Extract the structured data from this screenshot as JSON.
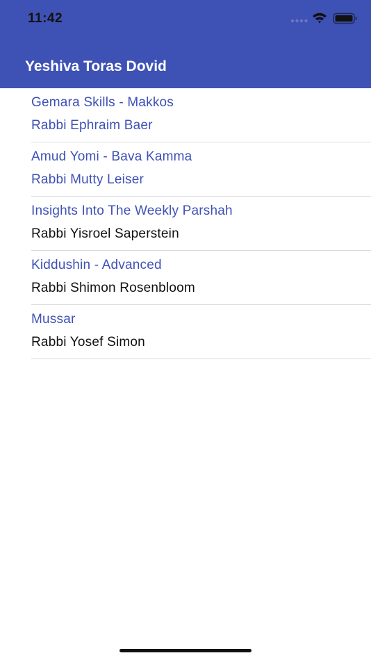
{
  "status_bar": {
    "time": "11:42",
    "icons": [
      "cellular-signal-icon",
      "wifi-icon",
      "battery-icon"
    ]
  },
  "header": {
    "title": "Yeshiva Toras Dovid",
    "background_color": "#3e51b5"
  },
  "colors": {
    "accent": "#3e51b5",
    "default_text": "#111111",
    "divider": "#dcdcdc"
  },
  "courses": [
    {
      "title": "Gemara Skills - Makkos",
      "rabbi": "Rabbi Ephraim Baer",
      "rabbi_color": "#3e51b5"
    },
    {
      "title": "Amud Yomi - Bava Kamma",
      "rabbi": "Rabbi Mutty Leiser",
      "rabbi_color": "#3e51b5"
    },
    {
      "title": "Insights Into The Weekly Parshah",
      "rabbi": "Rabbi Yisroel Saperstein",
      "rabbi_color": "#111111"
    },
    {
      "title": "Kiddushin - Advanced",
      "rabbi": "Rabbi Shimon Rosenbloom",
      "rabbi_color": "#111111"
    },
    {
      "title": "Mussar",
      "rabbi": "Rabbi Yosef Simon",
      "rabbi_color": "#111111"
    }
  ]
}
